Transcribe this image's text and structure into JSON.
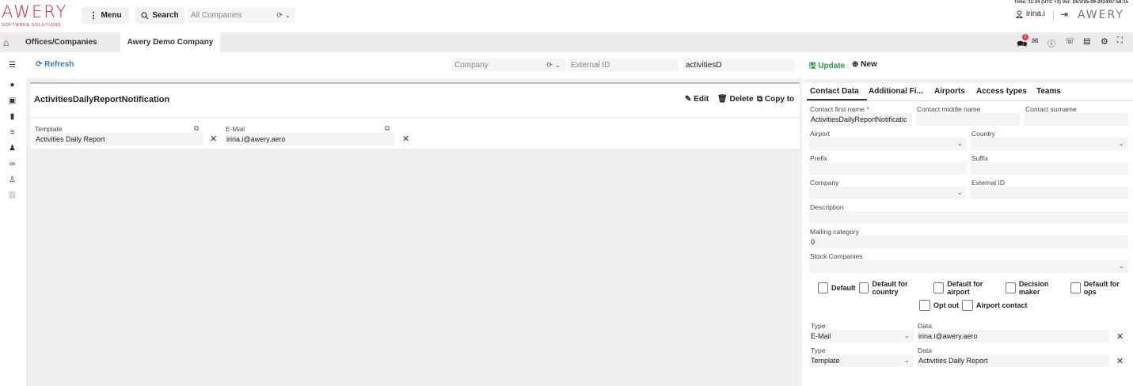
{
  "header": {
    "logo_text": "AWERY",
    "logo_sub": "SOFTWARE SOLUTIONS",
    "menu_label": "Menu",
    "search_label": "Search",
    "company_select": "All Companies",
    "time_info": "Time: 11:34 (UTC +3)   Ver: DEV/25-09-2024/07:58:15",
    "user": "irina.i",
    "right_logo": "AWERY"
  },
  "tabs": [
    {
      "label": "Offices/Companies"
    },
    {
      "label": "Awery Demo Company"
    }
  ],
  "notification_count": "1",
  "toolbar": {
    "refresh_label": "Refresh",
    "company_placeholder": "Company",
    "external_id_placeholder": "External ID",
    "search_value": "activitiesD"
  },
  "record": {
    "title": "ActivitiesDailyReportNotification",
    "edit_label": "Edit",
    "delete_label": "Delete",
    "copy_label": "Copy to",
    "template_label": "Template",
    "template_value": "Activities Daily Report",
    "email_label": "E-Mail",
    "email_value": "irina.i@awery.aero"
  },
  "rpanel": {
    "update_label": "Update",
    "new_label": "New",
    "tabs": [
      "Contact Data",
      "Additional Fi...",
      "Airports",
      "Access types",
      "Teams"
    ],
    "first_name_label": "Contact first name",
    "required_mark": "*",
    "first_name_value": "ActivitiesDailyReportNotificatic",
    "middle_name_label": "Contact middle name",
    "surname_label": "Contact surname",
    "airport_label": "Airport",
    "country_label": "Country",
    "prefix_label": "Prefix",
    "suffix_label": "Suffix",
    "company_label": "Company",
    "external_id_label": "External ID",
    "description_label": "Description",
    "mailing_label": "Mailing category",
    "mailing_value": "0",
    "stock_label": "Stock Companies",
    "checkboxes": [
      "Default",
      "Default for country",
      "Default for airport",
      "Decision maker",
      "Default for ops"
    ],
    "checkboxes2": [
      "Opt out",
      "Airport contact"
    ],
    "type_label": "Type",
    "data_label": "Data",
    "contacts": [
      {
        "type": "E-Mail",
        "data": "irina.i@awery.aero"
      },
      {
        "type": "Template",
        "data": "Activities Daily Report"
      }
    ]
  }
}
